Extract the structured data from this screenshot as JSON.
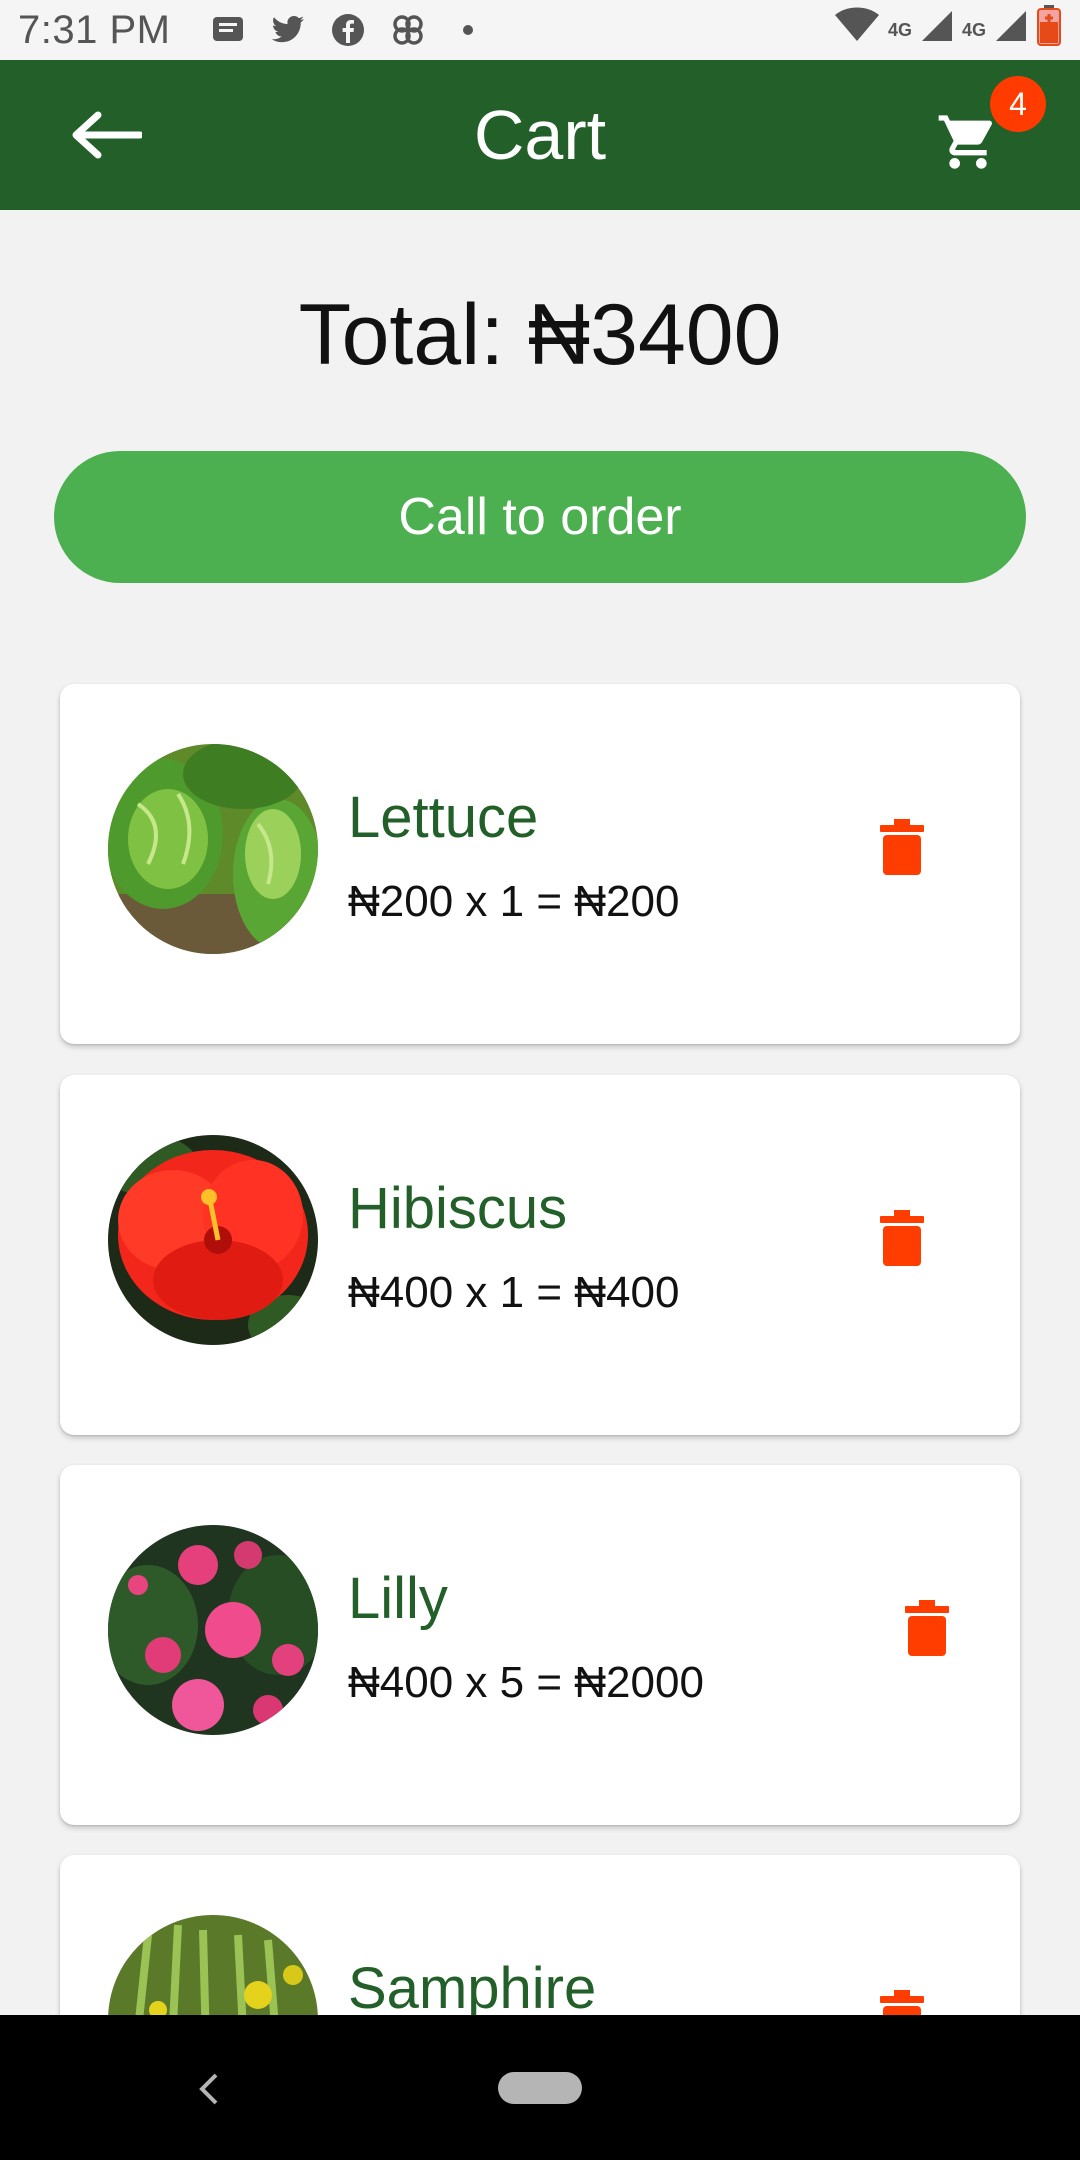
{
  "status_bar": {
    "time": "7:31 PM",
    "notification_icons": [
      "message-icon",
      "twitter-icon",
      "facebook-icon",
      "pinwheel-icon",
      "dot-icon"
    ],
    "network_labels": [
      "4G",
      "4G"
    ]
  },
  "app_bar": {
    "title": "Cart",
    "cart_count": "4",
    "color": "#235f28"
  },
  "summary": {
    "total": "Total: ₦3400"
  },
  "order_button": {
    "label": "Call to order",
    "color": "#4caf50"
  },
  "items": [
    {
      "name": "Lettuce",
      "price_line": "₦200 x 1 = ₦200",
      "image": "lettuce"
    },
    {
      "name": "Hibiscus",
      "price_line": "₦400 x 1 = ₦400",
      "image": "hibiscus"
    },
    {
      "name": "Lilly",
      "price_line": "₦400 x 5 = ₦2000",
      "image": "lilly"
    },
    {
      "name": "Samphire",
      "price_line": "",
      "image": "samphire"
    }
  ],
  "colors": {
    "delete": "#ff3d00",
    "item_name": "#235f28"
  }
}
